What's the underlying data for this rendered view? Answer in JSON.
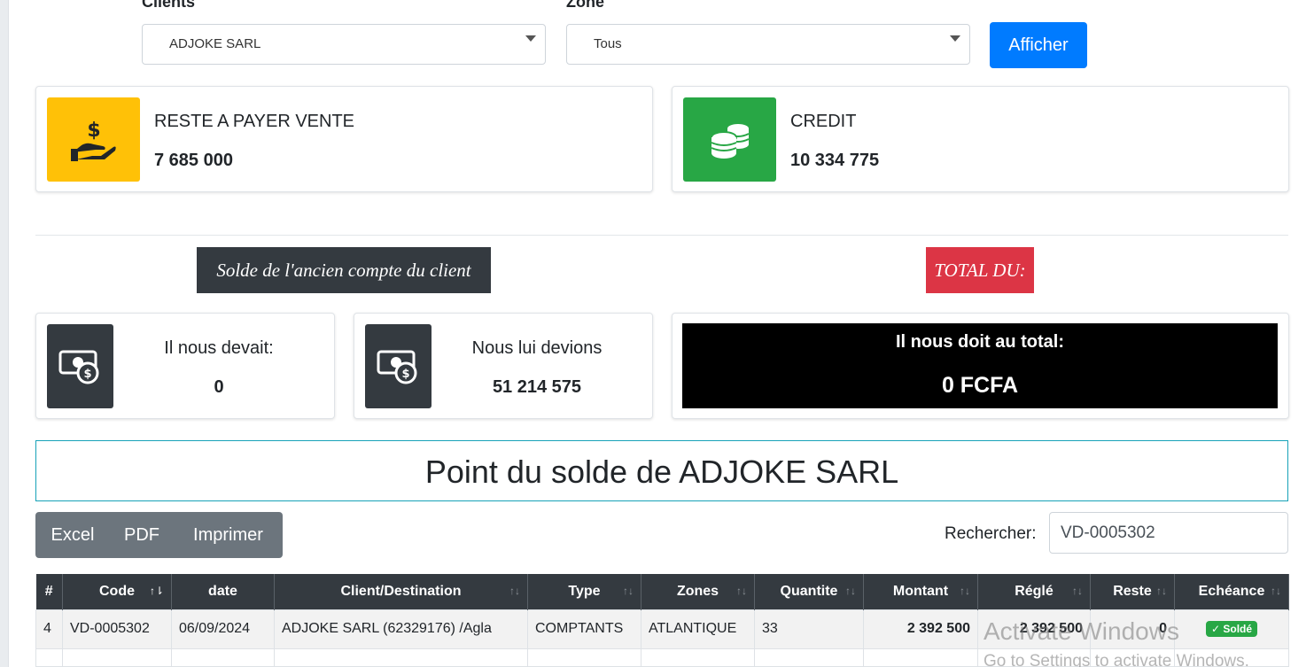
{
  "filters": {
    "client_label": "Clients",
    "client_value": "ADJOKE SARL",
    "zone_label": "Zone",
    "zone_value": "Tous",
    "submit_label": "Afficher"
  },
  "summary_cards": {
    "reste": {
      "title": "RESTE A PAYER VENTE",
      "value": "7 685 000",
      "icon": "hand-dollar-icon",
      "color": "#ffc107"
    },
    "credit": {
      "title": "CREDIT",
      "value": "10 334 775",
      "icon": "coins-icon",
      "color": "#28a745"
    }
  },
  "tags": {
    "ancien_compte": "Solde de l'ancien compte du client",
    "total_du": "TOTAL DU:"
  },
  "old_account": {
    "devait": {
      "label": "Il nous devait:",
      "value": "0"
    },
    "devions": {
      "label": "Nous lui devions",
      "value": "51 214 575"
    }
  },
  "total": {
    "label": "Il nous doit au total:",
    "value": "0 FCFA"
  },
  "report_title": "Point du solde de ADJOKE SARL",
  "export_buttons": {
    "excel": "Excel",
    "pdf": "PDF",
    "print": "Imprimer"
  },
  "search": {
    "label": "Rechercher:",
    "value": "VD-0005302"
  },
  "table": {
    "headers": [
      "#",
      "Code",
      "date",
      "Client/Destination",
      "Type",
      "Zones",
      "Quantite",
      "Montant",
      "Réglé",
      "Reste",
      "Echéance"
    ],
    "rows": [
      {
        "num": "4",
        "code": "VD-0005302",
        "date": "06/09/2024",
        "client": "ADJOKE SARL (62329176) /Agla",
        "type": "COMPTANTS",
        "zone": "ATLANTIQUE",
        "quantite": "33",
        "montant": "2 392 500",
        "regle": "2 392 500",
        "reste": "0",
        "echeance": "✓ Soldé"
      }
    ]
  },
  "watermark": {
    "line1": "Activate Windows",
    "line2": "Go to Settings to activate Windows."
  },
  "colors": {
    "primary": "#007bff",
    "dark": "#343a40",
    "danger": "#dc3545",
    "success": "#28a745",
    "warning": "#ffc107",
    "secondary": "#6c757d",
    "info": "#17a2b8"
  }
}
